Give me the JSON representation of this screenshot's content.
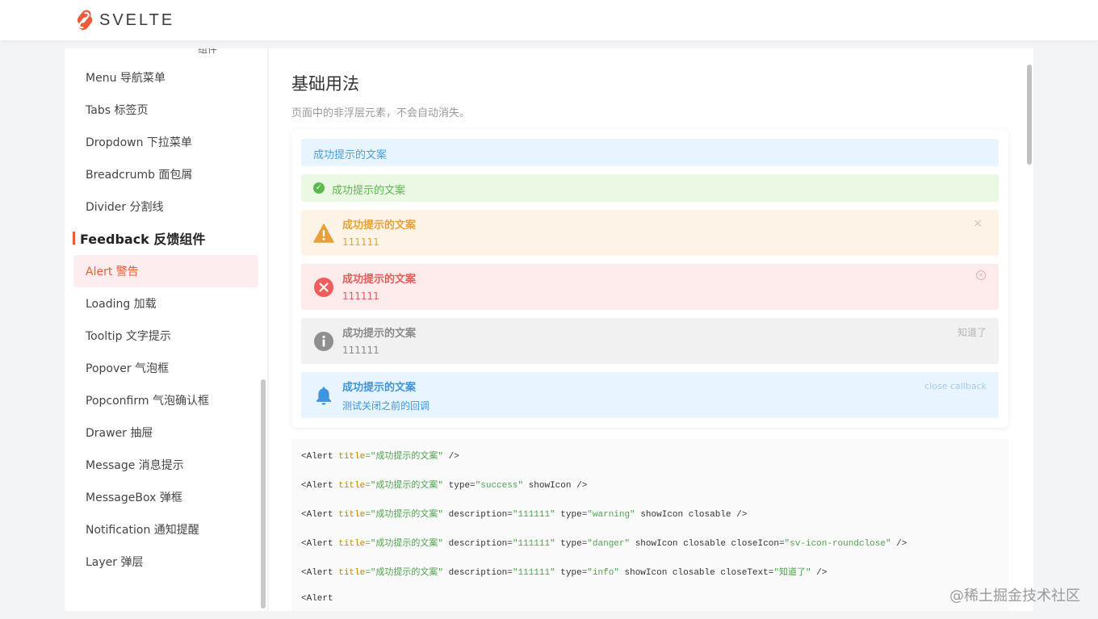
{
  "brand": {
    "name": "SVELTE",
    "accent": "#ee5a37"
  },
  "sidebar": {
    "top_cut_text": "组件",
    "items_before": [
      {
        "label": "Menu 导航菜单",
        "name": "sidebar-item-menu"
      },
      {
        "label": "Tabs 标签页",
        "name": "sidebar-item-tabs"
      },
      {
        "label": "Dropdown 下拉菜单",
        "name": "sidebar-item-dropdown"
      },
      {
        "label": "Breadcrumb 面包屑",
        "name": "sidebar-item-breadcrumb"
      },
      {
        "label": "Divider 分割线",
        "name": "sidebar-item-divider"
      }
    ],
    "group": "Feedback 反馈组件",
    "items_after": [
      {
        "label": "Alert 警告",
        "name": "sidebar-item-alert",
        "active": true
      },
      {
        "label": "Loading 加载",
        "name": "sidebar-item-loading"
      },
      {
        "label": "Tooltip 文字提示",
        "name": "sidebar-item-tooltip"
      },
      {
        "label": "Popover 气泡框",
        "name": "sidebar-item-popover"
      },
      {
        "label": "Popconfirm 气泡确认框",
        "name": "sidebar-item-popconfirm"
      },
      {
        "label": "Drawer 抽屉",
        "name": "sidebar-item-drawer"
      },
      {
        "label": "Message 消息提示",
        "name": "sidebar-item-message"
      },
      {
        "label": "MessageBox 弹框",
        "name": "sidebar-item-messagebox"
      },
      {
        "label": "Notification 通知提醒",
        "name": "sidebar-item-notification"
      },
      {
        "label": "Layer 弹层",
        "name": "sidebar-item-layer"
      }
    ]
  },
  "main": {
    "title": "基础用法",
    "description": "页面中的非浮层元素，不会自动消失。",
    "alerts": [
      {
        "type": "default",
        "title": "成功提示的文案"
      },
      {
        "type": "success",
        "title": "成功提示的文案",
        "icon": "check-circle-icon"
      },
      {
        "type": "warning",
        "title": "成功提示的文案",
        "description": "111111",
        "icon": "warning-triangle-icon",
        "close": "×"
      },
      {
        "type": "danger",
        "title": "成功提示的文案",
        "description": "111111",
        "icon": "close-circle-icon",
        "close": "×"
      },
      {
        "type": "info",
        "title": "成功提示的文案",
        "description": "111111",
        "icon": "info-circle-icon",
        "close": "知道了"
      },
      {
        "type": "bell",
        "title": "成功提示的文案",
        "description": "测试关闭之前的回调",
        "icon": "bell-icon",
        "close": "close callback"
      }
    ],
    "code_lines": [
      {
        "pre": "<Alert ",
        "attr": "title",
        "str": "=\"成功提示的文案\"",
        "rest": " />"
      },
      {
        "pre": "<Alert ",
        "attr": "title",
        "str": "=\"成功提示的文案\"",
        "rest": " type=",
        "str2": "\"success\"",
        "rest2": " showIcon />"
      },
      {
        "pre": "<Alert ",
        "attr": "title",
        "str": "=\"成功提示的文案\"",
        "rest": " description=",
        "str2": "\"111111\"",
        "rest2": " type=",
        "str3": "\"warning\"",
        "rest3": " showIcon closable />"
      },
      {
        "pre": "<Alert ",
        "attr": "title",
        "str": "=\"成功提示的文案\"",
        "rest": " description=",
        "str2": "\"111111\"",
        "rest2": " type=",
        "str3": "\"danger\"",
        "rest3": " showIcon closable closeIcon=",
        "str4": "\"sv-icon-roundclose\"",
        "rest4": " />"
      },
      {
        "pre": "<Alert ",
        "attr": "title",
        "str": "=\"成功提示的文案\"",
        "rest": " description=",
        "str2": "\"111111\"",
        "rest2": " type=",
        "str3": "\"info\"",
        "rest3": " showIcon closable closeText=",
        "str4": "\"知道了\"",
        "rest4": " />"
      },
      {
        "pre": "<Alert",
        "attr": "",
        "str": "",
        "rest": ""
      }
    ]
  },
  "watermark": "@稀土掘金技术社区"
}
